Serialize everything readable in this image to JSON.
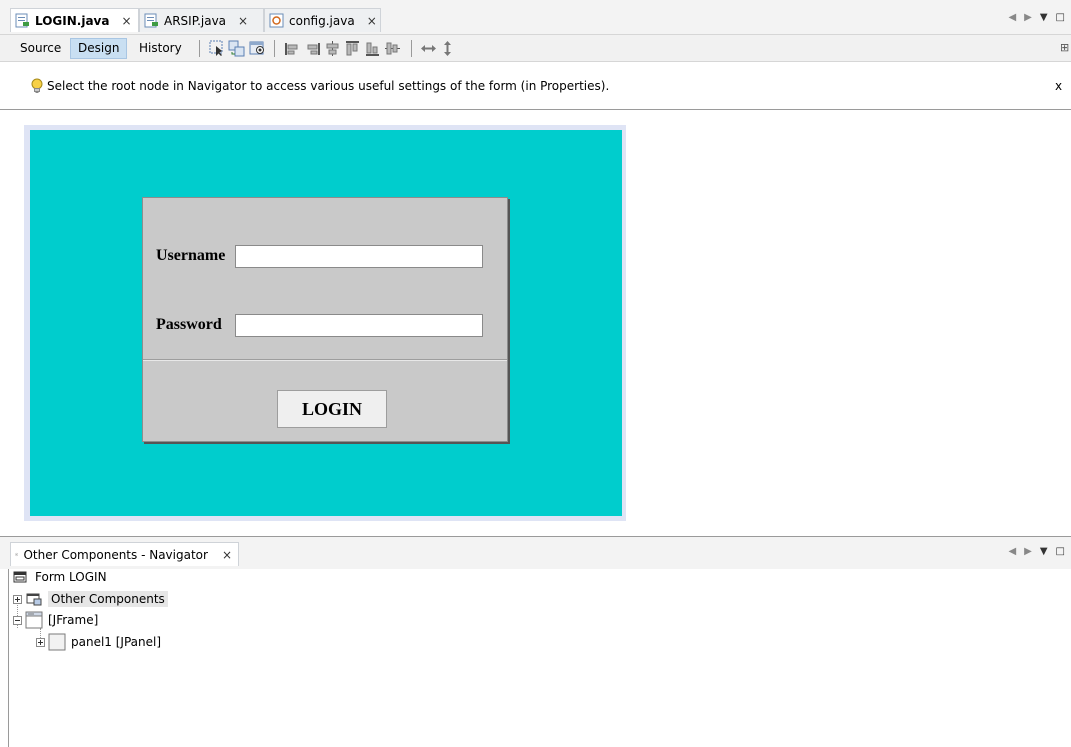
{
  "editor_tabs": [
    {
      "label": "LOGIN.java",
      "active": true,
      "close": "×"
    },
    {
      "label": "ARSIP.java",
      "active": false,
      "close": "×"
    },
    {
      "label": "config.java",
      "active": false,
      "close": "×"
    }
  ],
  "toolbar": {
    "source": "Source",
    "design": "Design",
    "history": "History",
    "selected": "Design"
  },
  "hint": {
    "text": "Select the root node in Navigator to access various useful settings of the form (in Properties).",
    "close": "x"
  },
  "form": {
    "username_label": "Username",
    "password_label": "Password",
    "username_value": "",
    "password_value": "",
    "login_button": "LOGIN",
    "background_color": "#00cdcd",
    "panel_color": "#c9c9c9"
  },
  "navigator": {
    "tab_title": "Other Components - Navigator",
    "close": "×",
    "tree": [
      {
        "label": "Form LOGIN"
      },
      {
        "label": "Other Components"
      },
      {
        "label": "[JFrame]"
      },
      {
        "label": "panel1 [JPanel]"
      }
    ]
  }
}
